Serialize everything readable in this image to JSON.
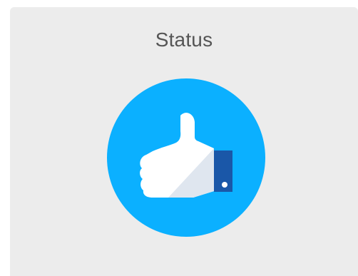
{
  "widget": {
    "title": "Status",
    "icon": "thumbs-up-icon",
    "colors": {
      "background": "#ececec",
      "title": "#555555",
      "circle": "#0bb0ff",
      "hand_light": "#ffffff",
      "hand_shadow": "#dfe6ef",
      "cuff": "#1a57a8"
    }
  }
}
